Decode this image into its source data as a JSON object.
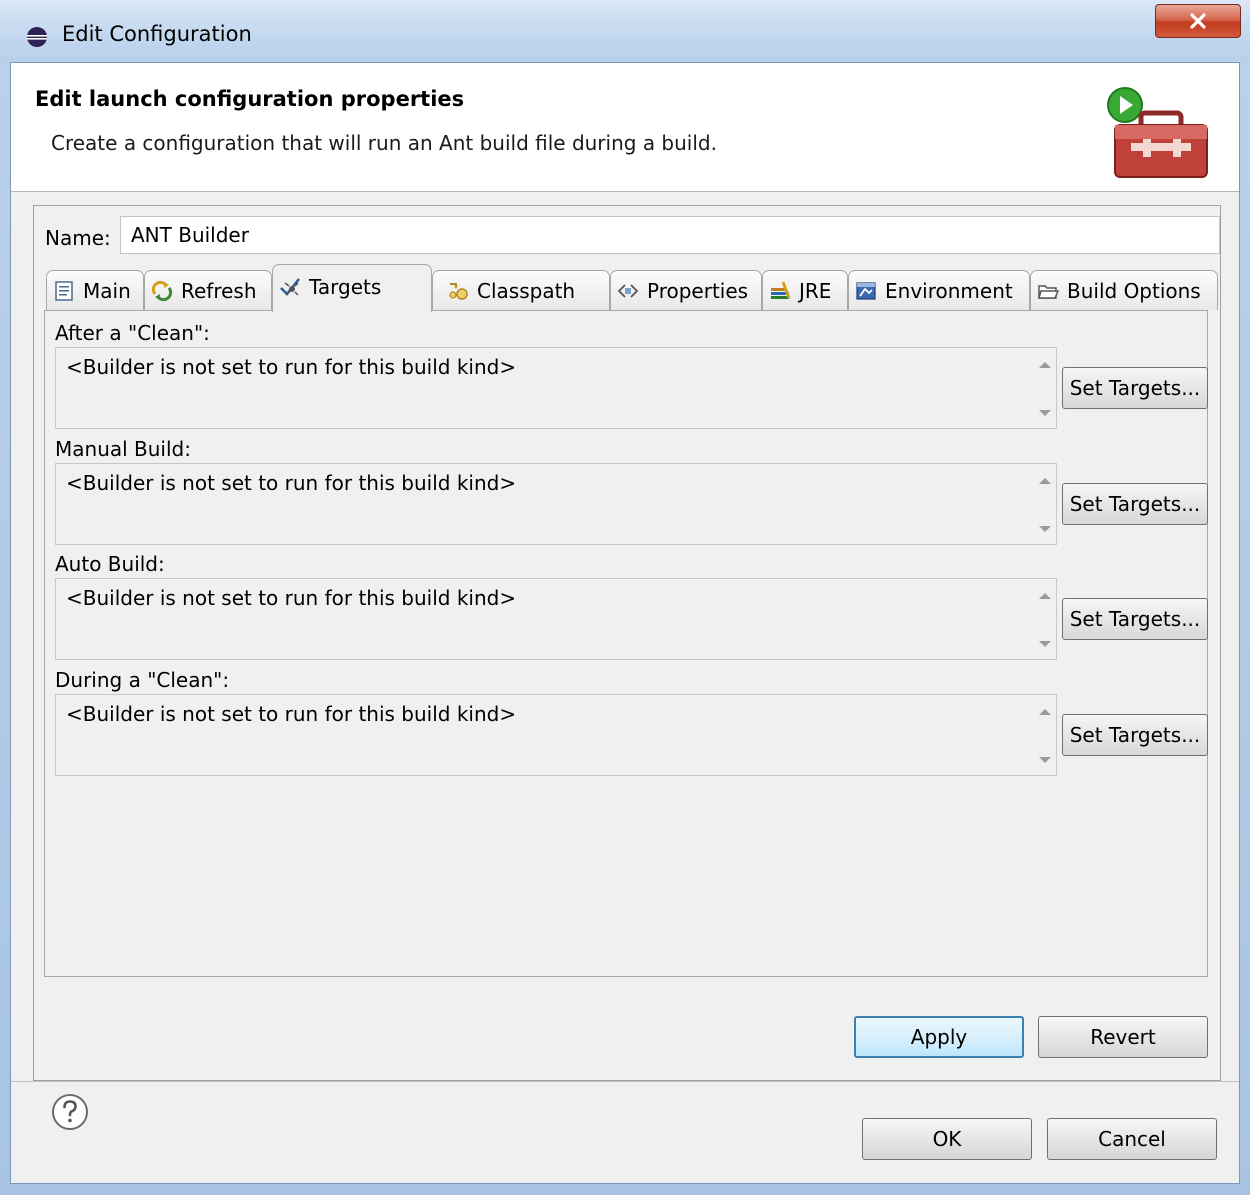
{
  "window": {
    "title": "Edit Configuration",
    "close_label": "X"
  },
  "header": {
    "title": "Edit launch configuration properties",
    "description": "Create a configuration that will run an Ant build file during a build.",
    "image_icon": "toolbox-run-icon"
  },
  "name_field": {
    "label": "Name:",
    "value": "ANT Builder"
  },
  "tabs": [
    {
      "label": "Main",
      "icon": "main-tab-icon",
      "active": false
    },
    {
      "label": "Refresh",
      "icon": "refresh-icon",
      "active": false
    },
    {
      "label": "Targets",
      "icon": "targets-icon",
      "active": true
    },
    {
      "label": "Classpath",
      "icon": "classpath-icon",
      "active": false
    },
    {
      "label": "Properties",
      "icon": "properties-icon",
      "active": false
    },
    {
      "label": "JRE",
      "icon": "jre-icon",
      "active": false
    },
    {
      "label": "Environment",
      "icon": "environment-icon",
      "active": false
    },
    {
      "label": "Build Options",
      "icon": "folder-icon",
      "active": false
    }
  ],
  "sections": [
    {
      "label": "After a \"Clean\":",
      "text": "<Builder is not set to run for this build kind>",
      "button": "Set Targets..."
    },
    {
      "label": "Manual Build:",
      "text": "<Builder is not set to run for this build kind>",
      "button": "Set Targets..."
    },
    {
      "label": "Auto Build:",
      "text": "<Builder is not set to run for this build kind>",
      "button": "Set Targets..."
    },
    {
      "label": "During a \"Clean\":",
      "text": "<Builder is not set to run for this build kind>",
      "button": "Set Targets..."
    }
  ],
  "actions": {
    "apply": "Apply",
    "revert": "Revert",
    "ok": "OK",
    "cancel": "Cancel"
  }
}
